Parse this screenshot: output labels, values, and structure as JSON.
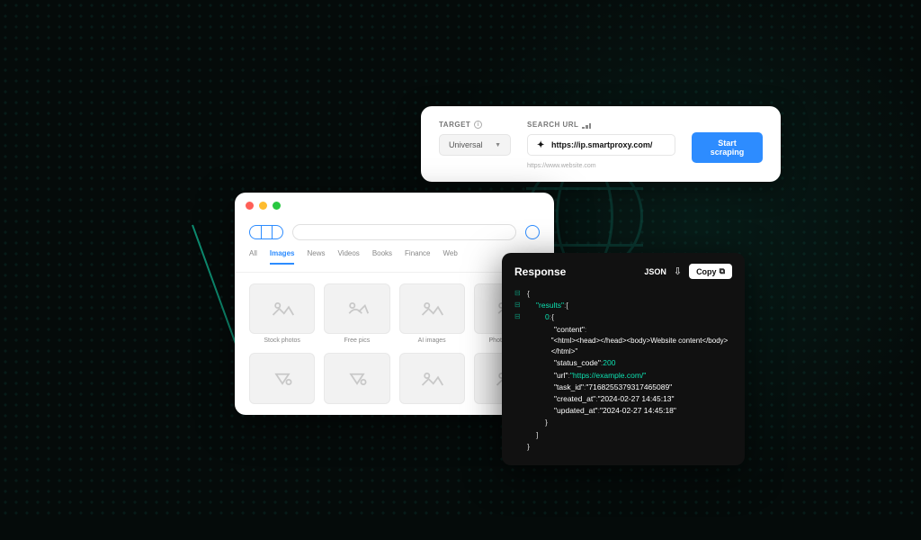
{
  "config": {
    "target_label": "TARGET",
    "target_value": "Universal",
    "url_label": "SEARCH URL",
    "url_value": "https://ip.smartproxy.com/",
    "url_helper": "https://www.website.com",
    "button": "Start scraping"
  },
  "browser": {
    "tabs": [
      "All",
      "Images",
      "News",
      "Videos",
      "Books",
      "Finance",
      "Web"
    ],
    "active_tab": 1,
    "cards": [
      "Stock photos",
      "Free pics",
      "AI images",
      "Photographs",
      "",
      "",
      "",
      ""
    ]
  },
  "response": {
    "title": "Response",
    "format": "JSON",
    "copy": "Copy",
    "json": {
      "results_key": "\"results\"",
      "index": "0",
      "content_key": "\"content\"",
      "content_val": "\"<html><head></head><body>Website content</body></html>\"",
      "status_key": "\"status_code\"",
      "status_val": "200",
      "url_key": "\"url\"",
      "url_val": "\"https://example.com/\"",
      "task_key": "\"task_id\"",
      "task_val": "\"7168255379317465089\"",
      "created_key": "\"created_at\"",
      "created_val": "\"2024-02-27 14:45:13\"",
      "updated_key": "\"updated_at\"",
      "updated_val": "\"2024-02-27 14:45:18\""
    }
  }
}
